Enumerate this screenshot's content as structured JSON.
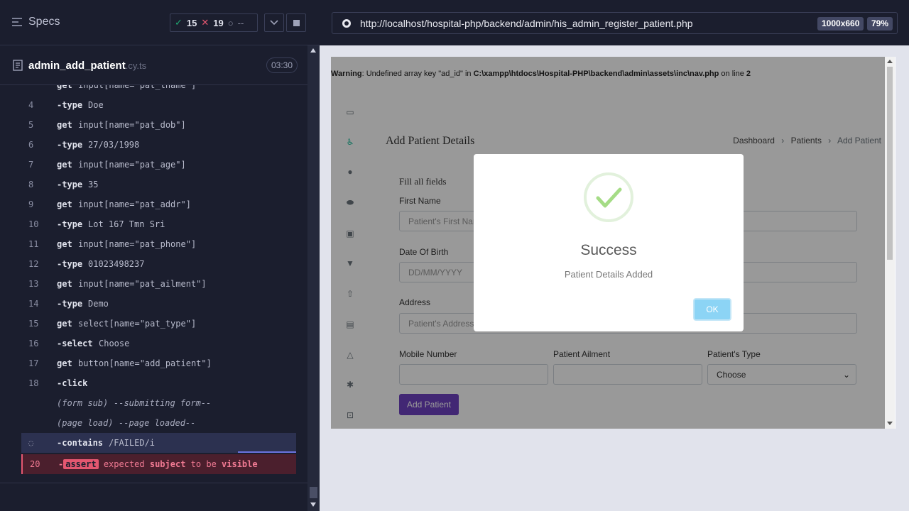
{
  "reporter": {
    "specs_label": "Specs",
    "passed": "15",
    "failed": "19",
    "pending": "--",
    "file_name": "admin_add_patient",
    "file_ext": ".cy.ts",
    "duration": "03:30"
  },
  "commands": [
    {
      "num": "",
      "name": "get",
      "msg": "input[name=\"pat_lname\"]"
    },
    {
      "num": "4",
      "name": "-type",
      "msg": "Doe"
    },
    {
      "num": "5",
      "name": "get",
      "msg": "input[name=\"pat_dob\"]"
    },
    {
      "num": "6",
      "name": "-type",
      "msg": "27/03/1998"
    },
    {
      "num": "7",
      "name": "get",
      "msg": "input[name=\"pat_age\"]"
    },
    {
      "num": "8",
      "name": "-type",
      "msg": "35"
    },
    {
      "num": "9",
      "name": "get",
      "msg": "input[name=\"pat_addr\"]"
    },
    {
      "num": "10",
      "name": "-type",
      "msg": "Lot 167 Tmn Sri"
    },
    {
      "num": "11",
      "name": "get",
      "msg": "input[name=\"pat_phone\"]"
    },
    {
      "num": "12",
      "name": "-type",
      "msg": "01023498237"
    },
    {
      "num": "13",
      "name": "get",
      "msg": "input[name=\"pat_ailment\"]"
    },
    {
      "num": "14",
      "name": "-type",
      "msg": "Demo"
    },
    {
      "num": "15",
      "name": "get",
      "msg": "select[name=\"pat_type\"]"
    },
    {
      "num": "16",
      "name": "-select",
      "msg": "Choose"
    },
    {
      "num": "17",
      "name": "get",
      "msg": "button[name=\"add_patient\"]"
    },
    {
      "num": "18",
      "name": "-click",
      "msg": ""
    }
  ],
  "events": [
    {
      "name": "(form sub)",
      "msg": "--submitting form--"
    },
    {
      "name": "(page load)",
      "msg": "--page loaded--"
    }
  ],
  "pending_cmd": {
    "name": "-contains",
    "msg": "/FAILED/i"
  },
  "failed_cmd": {
    "num": "20",
    "dash": "-",
    "badge": "assert",
    "w1": "expected",
    "w2": "subject",
    "w3": "to be",
    "w4": "visible"
  },
  "browser": {
    "url": "http://localhost/hospital-php/backend/admin/his_admin_register_patient.php",
    "viewport": "1000x660",
    "zoom": "79%"
  },
  "page": {
    "warning_label": "Warning",
    "warning_text": ": Undefined array key \"ad_id\" in ",
    "warning_path": "C:\\xampp\\htdocs\\Hospital-PHP\\backend\\admin\\assets\\inc\\nav.php",
    "warning_line_label": " on line ",
    "warning_line": "2",
    "title": "Add Patient Details",
    "crumbs": [
      "Dashboard",
      "Patients",
      "Add Patient"
    ],
    "fill_all": "Fill all fields",
    "first_name_label": "First Name",
    "first_name_ph": "Patient's First Name",
    "dob_label": "Date Of Birth",
    "dob_ph": "DD/MM/YYYY",
    "address_label": "Address",
    "address_ph": "Patient's Addresss",
    "mobile_label": "Mobile Number",
    "ailment_label": "Patient Ailment",
    "type_label": "Patient's Type",
    "type_value": "Choose",
    "add_button": "Add Patient"
  },
  "modal": {
    "title": "Success",
    "text": "Patient Details Added",
    "ok": "OK"
  },
  "colors": {
    "pass": "#1fa971",
    "fail": "#e45770",
    "accent": "#6f42c1"
  }
}
